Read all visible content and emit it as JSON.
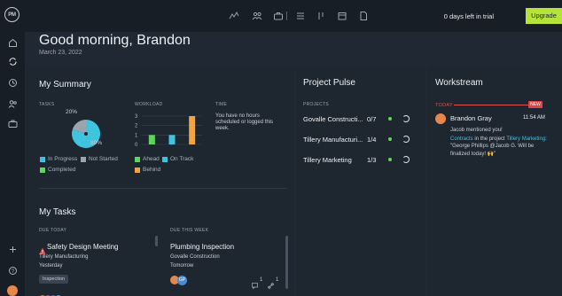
{
  "app": {
    "logo_text": "PM",
    "trial_text": "0 days left in trial",
    "upgrade_label": "Upgrade",
    "colors": {
      "accent": "#b5e33a",
      "teal": "#3fc4e0",
      "gray": "#9aa3ae",
      "green": "#5fd45f",
      "orange": "#f5a33c",
      "red": "#e04545"
    }
  },
  "toolbar_icons": [
    "activity-icon",
    "team-icon",
    "briefcase-icon",
    "list-icon",
    "filter-icon",
    "calendar-icon",
    "file-icon"
  ],
  "sidebar_icons": [
    "home-icon",
    "sync-icon",
    "clock-icon",
    "people-icon",
    "briefcase-icon",
    "plus-icon",
    "help-icon"
  ],
  "header": {
    "greeting": "Good morning, Brandon",
    "date": "March 23, 2022"
  },
  "summary": {
    "title": "My Summary",
    "tasks_label": "TASKS",
    "workload_label": "WORKLOAD",
    "time_label": "TIME",
    "time_text": "You have no hours scheduled or logged this week.",
    "legend_tasks": [
      "In Progress",
      "Not Started",
      "Completed"
    ],
    "legend_workload": [
      "Ahead",
      "On Track",
      "Behind"
    ],
    "chart_data": {
      "tasks_pie": {
        "type": "pie",
        "slices": [
          {
            "label": "In Progress",
            "percent": 80,
            "color": "#3fc4e0"
          },
          {
            "label": "Not Started",
            "percent": 20,
            "color": "#9aa3ae"
          }
        ],
        "labels": [
          "20%",
          "80%"
        ]
      },
      "workload_bar": {
        "type": "bar",
        "categories": [
          "Ahead",
          "On Track",
          "Behind"
        ],
        "values": [
          1,
          1,
          3
        ],
        "colors": [
          "#5fd45f",
          "#3fc4e0",
          "#f5a33c"
        ],
        "ylim": [
          0,
          3
        ],
        "ticks": [
          "3",
          "2",
          "1",
          "0"
        ]
      }
    }
  },
  "tasks": {
    "title": "My Tasks",
    "due_today_label": "DUE TODAY",
    "due_week_label": "DUE THIS WEEK",
    "today": {
      "title": "Safety Design Meeting",
      "project": "Tillery Manufacturing",
      "due": "Yesterday",
      "tag": "Inspection"
    },
    "week": {
      "title": "Plumbing Inspection",
      "project": "Govalle Construction",
      "due": "Tomorrow",
      "avatar_initials": "GP",
      "comments": "1",
      "links": "1"
    }
  },
  "pulse": {
    "title": "Project Pulse",
    "projects_label": "PROJECTS",
    "rows": [
      {
        "name": "Govalle Constructi...",
        "count": "0/7"
      },
      {
        "name": "Tillery Manufacturi...",
        "count": "1/4"
      },
      {
        "name": "Tillery Marketing",
        "count": "1/3"
      }
    ]
  },
  "stream": {
    "title": "Workstream",
    "today_label": "TODAY",
    "new_badge": "NEW",
    "user": "Brandon Gray",
    "time": "11:54 AM",
    "mention": "Jacob mentioned you!",
    "body_link1": "Contracts",
    "body_mid": " in the project ",
    "body_link2": "Tillery Marketing",
    "body_rest": ": \"George Phillips @Jacob G. Will be finalized today! 🙌\""
  }
}
